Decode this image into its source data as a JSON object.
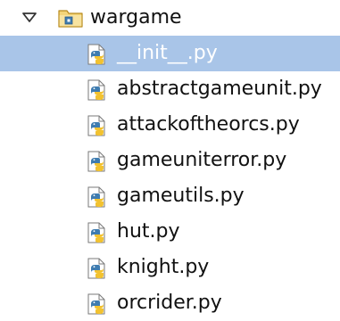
{
  "tree": {
    "folder": {
      "label": "wargame",
      "expanded": true,
      "expander_icon": "triangle-down-icon",
      "icon": "python-package-folder-icon"
    },
    "files": [
      {
        "label": "__init__.py",
        "selected": true,
        "icon": "python-file-icon"
      },
      {
        "label": "abstractgameunit.py",
        "selected": false,
        "icon": "python-file-icon"
      },
      {
        "label": "attackoftheorcs.py",
        "selected": false,
        "icon": "python-file-icon"
      },
      {
        "label": "gameuniterror.py",
        "selected": false,
        "icon": "python-file-icon"
      },
      {
        "label": "gameutils.py",
        "selected": false,
        "icon": "python-file-icon"
      },
      {
        "label": "hut.py",
        "selected": false,
        "icon": "python-file-icon"
      },
      {
        "label": "knight.py",
        "selected": false,
        "icon": "python-file-icon"
      },
      {
        "label": "orcrider.py",
        "selected": false,
        "icon": "python-file-icon"
      }
    ]
  },
  "colors": {
    "selection_background": "#a9c5e8",
    "selection_text": "#ffffff",
    "text": "#111111",
    "folder_icon": "#e8c25a",
    "python_blue": "#3f7cb0",
    "python_yellow": "#f2c230"
  }
}
